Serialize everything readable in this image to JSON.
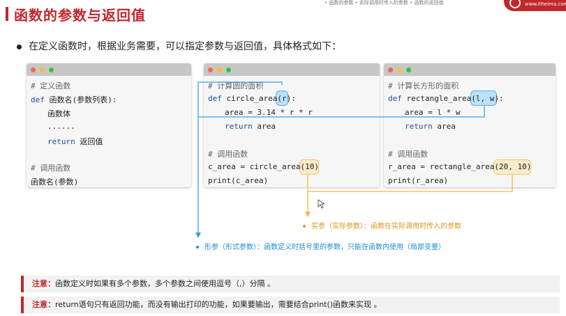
{
  "slide": {
    "title": "函数的参数与返回值",
    "top_banner": "• 函数的参数 • 实际调用时传入的参数 • 函数的返回值",
    "logo_text": "www.itheima.com",
    "intro": "在定义函数时，根据业务需要，可以指定参数与返回值，具体格式如下："
  },
  "box1": {
    "lines": [
      "# 定义函数",
      "def",
      " 函数名(参数列表):",
      "函数体",
      "......",
      "return",
      " 返回值",
      "# 调用函数",
      "函数名(参数)"
    ]
  },
  "box2": {
    "comment1": "# 计算圆的面积",
    "def_kw": "def",
    "def_rest_a": " circle_area(",
    "param": "r",
    "def_rest_b": "):",
    "body1": "area = 3.14 * r * r",
    "return_kw": "return",
    "return_rest": " area",
    "comment2": "# 调用函数",
    "call_a": "c_area = circle_area(",
    "arg": "10",
    "call_b": ")",
    "print": "print(c_area)"
  },
  "box3": {
    "comment1": "# 计算长方形的面积",
    "def_kw": "def",
    "def_rest_a": " rectangle_area(",
    "param": "l, w",
    "def_rest_b": "):",
    "body1": "area = l * w",
    "return_kw": "return",
    "return_rest": " area",
    "comment2": "# 调用函数",
    "call_a": "r_area = rectangle_area(",
    "arg": "20, 10",
    "call_b": ")",
    "print": "print(r_area)"
  },
  "annotations": {
    "actual": "实参（实际参数）：函数在实际调用时传入的参数",
    "formal": "形参（形式参数）：函数定义时括号里的参数，只能在函数内使用（局部变量）"
  },
  "notes": [
    {
      "label": "注意：",
      "text": "函数定义时如果有多个参数，多个参数之间使用逗号（,）分隔 。"
    },
    {
      "label": "注意：",
      "text": "return语句只有返回功能，而没有输出打印的功能，如果要输出，需要结合print()函数来实现 。"
    }
  ],
  "colors": {
    "brand_red": "#c1272d",
    "formal_blue": "#1a8fd3",
    "actual_yellow": "#d99a1a"
  }
}
